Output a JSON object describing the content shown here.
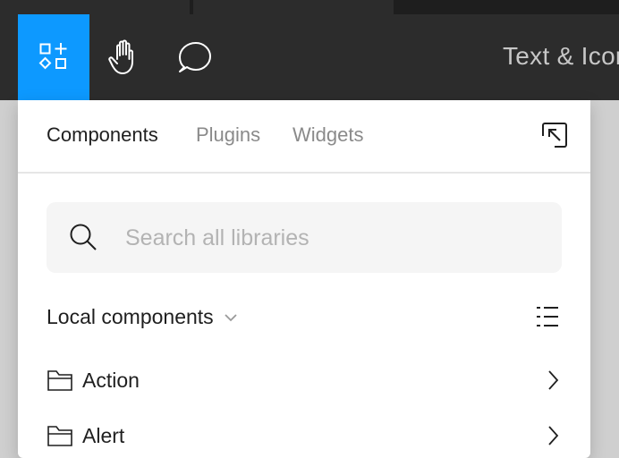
{
  "toolbar": {
    "tools": [
      {
        "icon": "resources-icon",
        "active": true
      },
      {
        "icon": "hand-icon",
        "active": false
      },
      {
        "icon": "comment-icon",
        "active": false
      }
    ],
    "file_title": "Text & Icons"
  },
  "panel": {
    "tabs": [
      "Components",
      "Plugins",
      "Widgets"
    ],
    "selected_tab": "Components",
    "collapse_icon": "collapse-arrow-icon"
  },
  "search": {
    "placeholder": "Search all libraries",
    "value": ""
  },
  "section": {
    "title": "Local components",
    "view_icon": "list-view-icon"
  },
  "items": [
    {
      "label": "Action",
      "icon": "folder-icon"
    },
    {
      "label": "Alert",
      "icon": "folder-icon"
    }
  ],
  "colors": {
    "accent": "#0d99ff",
    "toolbar_bg": "#2c2c2c"
  }
}
